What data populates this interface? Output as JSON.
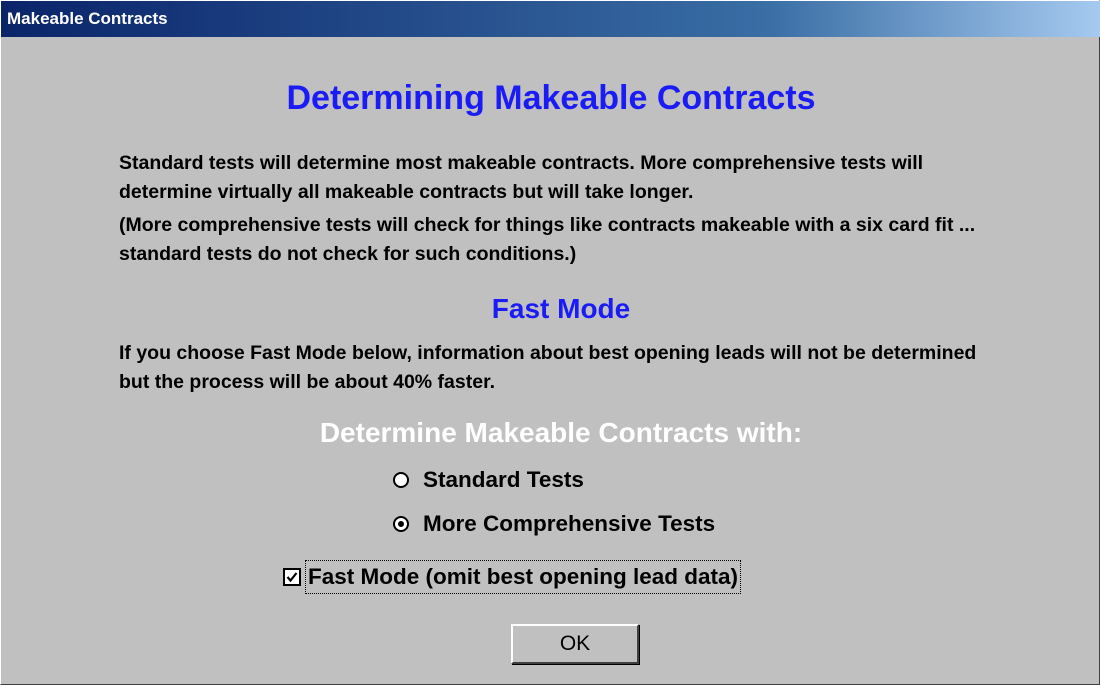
{
  "window": {
    "title": "Makeable Contracts"
  },
  "main": {
    "title": "Determining Makeable Contracts",
    "paragraph1": "Standard tests will determine most makeable contracts. More comprehensive tests will determine virtually all makeable contracts but will take longer.",
    "paragraph2": "(More comprehensive tests will check for things like contracts makeable with a six card fit ... standard tests do not check for such conditions.)",
    "fast_mode_title": "Fast Mode",
    "fast_mode_text": "If you choose Fast Mode below, information about best opening leads will not be determined but the process will be about 40% faster.",
    "options_heading": "Determine Makeable Contracts with:"
  },
  "options": {
    "standard_label": "Standard Tests",
    "standard_selected": false,
    "comprehensive_label": "More Comprehensive Tests",
    "comprehensive_selected": true,
    "fast_mode_label": "Fast Mode (omit best opening lead data)",
    "fast_mode_checked": true
  },
  "buttons": {
    "ok_label": "OK"
  },
  "colors": {
    "title_blue": "#1b1bf5",
    "dialog_gray": "#c0c0c0",
    "titlebar_start": "#0a246a",
    "titlebar_end": "#a6caf0"
  }
}
